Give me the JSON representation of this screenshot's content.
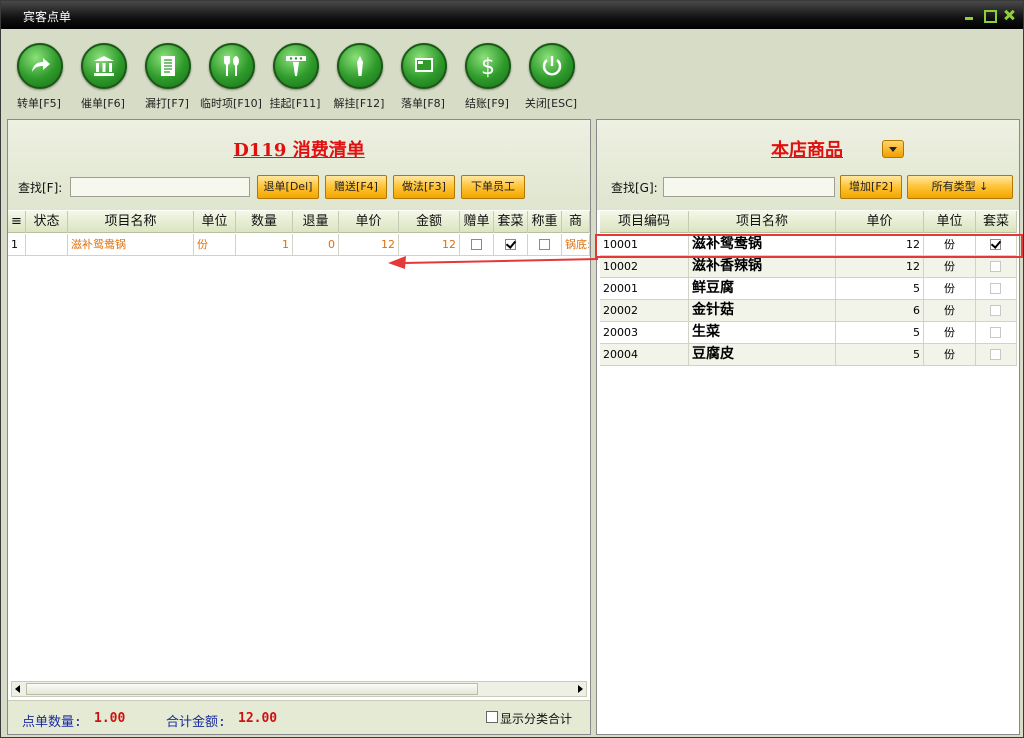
{
  "window": {
    "title": "宾客点单"
  },
  "toolbar": [
    {
      "label": "转单[F5]",
      "icon": "forward-arrow-icon"
    },
    {
      "label": "催单[F6]",
      "icon": "bank-icon"
    },
    {
      "label": "漏打[F7]",
      "icon": "document-icon"
    },
    {
      "label": "临时项[F10]",
      "icon": "cutlery-icon"
    },
    {
      "label": "挂起[F11]",
      "icon": "hang-icon"
    },
    {
      "label": "解挂[F12]",
      "icon": "unhang-icon"
    },
    {
      "label": "落单[F8]",
      "icon": "screen-icon"
    },
    {
      "label": "结账[F9]",
      "icon": "dollar-icon"
    },
    {
      "label": "关闭[ESC]",
      "icon": "power-icon"
    }
  ],
  "left": {
    "title": "D119 消费清单",
    "search_label": "查找[F]:",
    "search_value": "",
    "buttons": [
      "退单[Del]",
      "赠送[F4]",
      "做法[F3]",
      "下单员工"
    ],
    "columns": [
      "≡",
      "状态",
      "项目名称",
      "单位",
      "数量",
      "退量",
      "单价",
      "金额",
      "赠单",
      "套菜",
      "称重",
      "商"
    ],
    "rows": [
      {
        "idx": "1",
        "status": "",
        "name": "滋补鸳鸯锅",
        "unit": "份",
        "qty": "1",
        "ret": "0",
        "price": "12",
        "amount": "12",
        "gift": false,
        "set": true,
        "weigh": false,
        "extra": "锅底:"
      }
    ],
    "footer": {
      "count_label": "点单数量:",
      "count_value": "1.00",
      "total_label": "合计金额:",
      "total_value": "12.00",
      "show_category": "显示分类合计"
    }
  },
  "right": {
    "title": "本店商品",
    "search_label": "查找[G]:",
    "search_value": "",
    "add_button": "增加[F2]",
    "type_button": "所有类型 ↓",
    "columns": [
      "项目编码",
      "项目名称",
      "单价",
      "单位",
      "套菜"
    ],
    "rows": [
      {
        "code": "10001",
        "name": "滋补鸳鸯锅",
        "price": "12",
        "unit": "份",
        "set": true
      },
      {
        "code": "10002",
        "name": "滋补香辣锅",
        "price": "12",
        "unit": "份",
        "set": false
      },
      {
        "code": "20001",
        "name": "鲜豆腐",
        "price": "5",
        "unit": "份",
        "set": false
      },
      {
        "code": "20002",
        "name": "金针菇",
        "price": "6",
        "unit": "份",
        "set": false
      },
      {
        "code": "20003",
        "name": "生菜",
        "price": "5",
        "unit": "份",
        "set": false
      },
      {
        "code": "20004",
        "name": "豆腐皮",
        "price": "5",
        "unit": "份",
        "set": false
      }
    ]
  },
  "colors": {
    "accent_green": "#2d9a2a",
    "title_red": "#e01010",
    "row_text_orange": "#e0700a",
    "highlight": "#e53838"
  }
}
